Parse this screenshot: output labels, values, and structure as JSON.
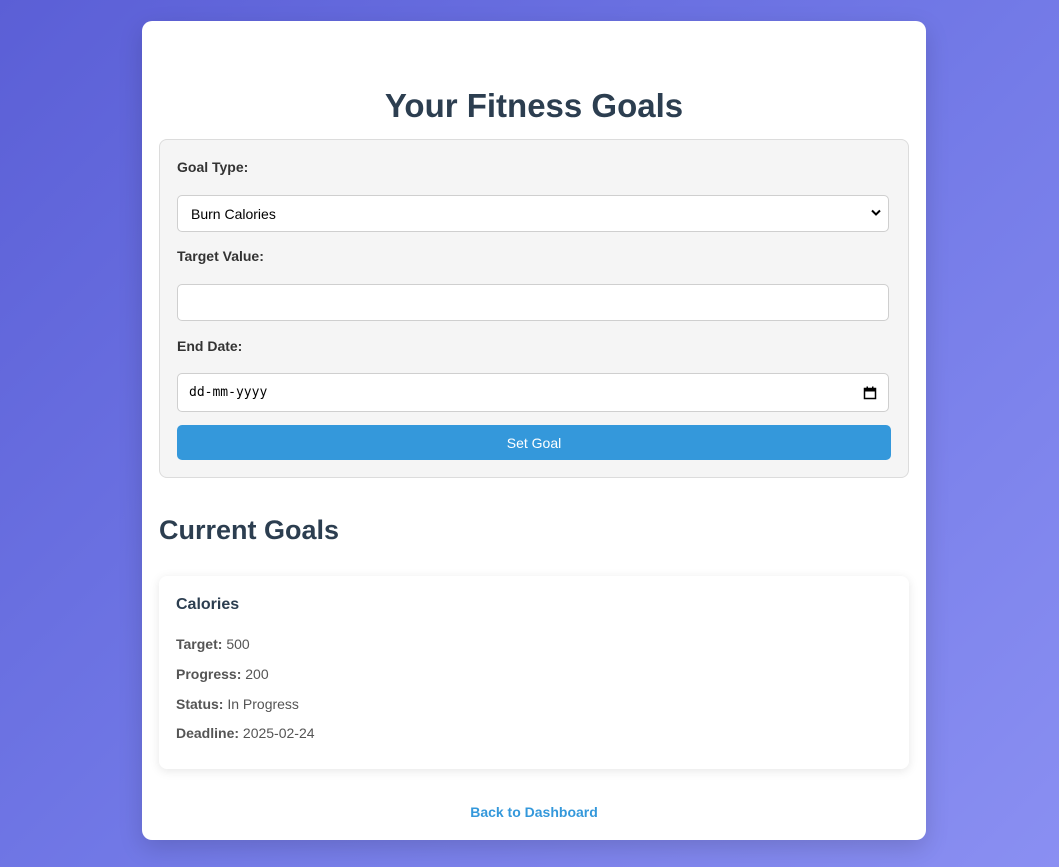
{
  "page": {
    "title": "Your Fitness Goals"
  },
  "form": {
    "goal_type_label": "Goal Type:",
    "goal_type_selected": "Burn Calories",
    "target_value_label": "Target Value:",
    "target_value_value": "",
    "end_date_label": "End Date:",
    "end_date_placeholder": "dd-mm-yyyy",
    "submit_label": "Set Goal"
  },
  "current_goals": {
    "heading": "Current Goals",
    "items": [
      {
        "title": "Calories",
        "target_label": "Target:",
        "target_value": "500",
        "progress_label": "Progress:",
        "progress_value": "200",
        "status_label": "Status:",
        "status_value": "In Progress",
        "deadline_label": "Deadline:",
        "deadline_value": "2025-02-24"
      }
    ]
  },
  "footer": {
    "back_link": "Back to Dashboard"
  },
  "colors": {
    "accent": "#3498db",
    "heading": "#2c3e50",
    "background_gradient_start": "#5b5fd6",
    "background_gradient_end": "#8a8ff2"
  },
  "icons": {
    "select": "chevron-down-icon",
    "date": "calendar-icon"
  }
}
